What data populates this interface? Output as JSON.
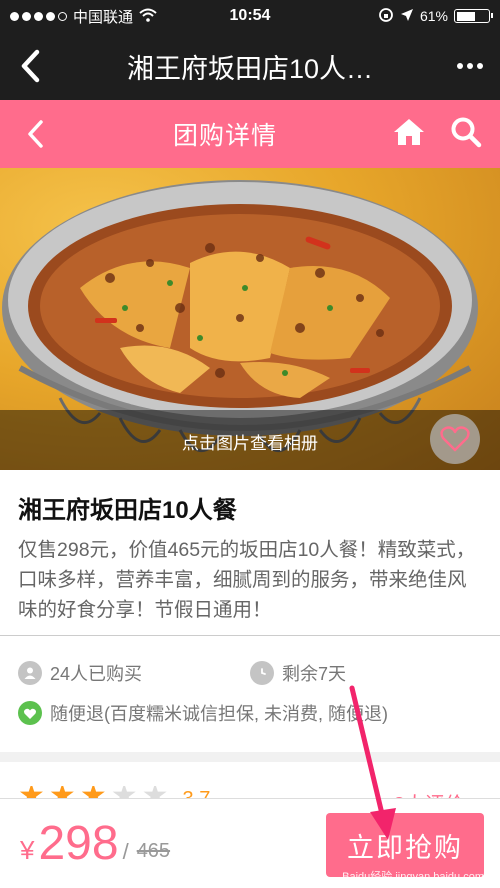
{
  "status_bar": {
    "carrier": "中国联通",
    "time": "10:54",
    "battery": "61%",
    "battery_level": 0.61
  },
  "nav": {
    "title": "湘王府坂田店10人…"
  },
  "header": {
    "title": "团购详情"
  },
  "hero": {
    "caption": "点击图片查看相册"
  },
  "deal": {
    "title": "湘王府坂田店10人餐",
    "description": "仅售298元，价值465元的坂田店10人餐！精致菜式，口味多样，营养丰富，细腻周到的服务，带来绝佳风味的好食分享！节假日通用！"
  },
  "meta": {
    "purchased": "24人已购买",
    "remaining": "剩余7天",
    "refund": "随便退(百度糯米诚信担保, 未消费, 随便退)"
  },
  "rating": {
    "stars": 3,
    "score": "3.7",
    "reviews": "3人评价 >"
  },
  "bottom": {
    "currency": "¥",
    "price": "298",
    "original_price": "465",
    "buy_label": "立即抢购",
    "watermark": "Baidu经验 jingyan.baidu.com"
  },
  "colors": {
    "brand_pink": "#ff6c8c",
    "star_orange": "#ff9a1a",
    "refund_green": "#5cc14e"
  },
  "icons": [
    "back-chevron-icon",
    "more-dots-icon",
    "home-icon",
    "search-icon",
    "heart-icon",
    "user-icon",
    "clock-icon",
    "check-heart-icon",
    "star-icon"
  ]
}
